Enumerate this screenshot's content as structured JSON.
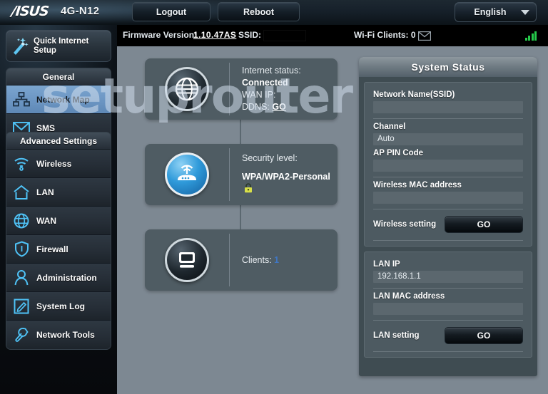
{
  "topbar": {
    "brand": "/ISUS",
    "model": "4G-N12",
    "logout_label": "Logout",
    "reboot_label": "Reboot",
    "language": "English",
    "caret_icon": "chevron-down-icon"
  },
  "infobar": {
    "firmware_label": "Firmware Version:",
    "firmware_version": "1.10.47AS",
    "ssid_label": "SSID:",
    "ssid_value": "",
    "wifi_clients": "Wi-Fi Clients: 0",
    "mail_icon": "envelope-icon",
    "signal_icon": "signal-bars-icon"
  },
  "sidebar": {
    "quick_setup": {
      "label_line1": "Quick Internet",
      "label_line2": "Setup",
      "icon": "magic-wand-icon"
    },
    "groups": [
      {
        "title": "General",
        "items": [
          {
            "label": "Network Map",
            "icon": "network-map-icon",
            "active": true
          },
          {
            "label": "SMS",
            "icon": "envelope-icon",
            "active": false
          }
        ]
      },
      {
        "title": "Advanced Settings",
        "items": [
          {
            "label": "Wireless",
            "icon": "wifi-icon",
            "active": false
          },
          {
            "label": "LAN",
            "icon": "house-icon",
            "active": false
          },
          {
            "label": "WAN",
            "icon": "globe-icon",
            "active": false
          },
          {
            "label": "Firewall",
            "icon": "shield-icon",
            "active": false
          },
          {
            "label": "Administration",
            "icon": "person-icon",
            "active": false
          },
          {
            "label": "System Log",
            "icon": "pencil-note-icon",
            "active": false
          },
          {
            "label": "Network Tools",
            "icon": "wrench-icon",
            "active": false
          }
        ]
      }
    ]
  },
  "watermark": "setuprouter",
  "network_map": {
    "internet": {
      "icon": "globe-icon",
      "status_label": "Internet status:",
      "status_value": "Connected",
      "wan_ip_label": "WAN IP:",
      "wan_ip_value": "",
      "ddns_label": "DDNS:",
      "ddns_link": "GO"
    },
    "security": {
      "icon": "router-icon",
      "label": "Security level:",
      "value": "WPA/WPA2-Personal",
      "lock_icon": "lock-icon"
    },
    "clients": {
      "icon": "computer-icon",
      "label": "Clients:",
      "count": "1"
    }
  },
  "system_status": {
    "title": "System Status",
    "wireless": {
      "ssid_label": "Network Name(SSID)",
      "ssid_value": "",
      "channel_label": "Channel",
      "channel_value": "Auto",
      "appin_label": "AP PIN Code",
      "appin_value": "",
      "wmac_label": "Wireless MAC address",
      "wmac_value": "",
      "setting_label": "Wireless setting",
      "setting_button": "GO"
    },
    "lan": {
      "ip_label": "LAN IP",
      "ip_value": "192.168.1.1",
      "mac_label": "LAN MAC address",
      "mac_value": "",
      "setting_label": "LAN setting",
      "setting_button": "GO"
    }
  },
  "colors": {
    "accent_blue": "#3f76c4",
    "sidebar_active": "#6d97c4",
    "page_bg": "#7d8892",
    "panel_bg": "#4f5c63",
    "signal_green": "#25c84a"
  }
}
